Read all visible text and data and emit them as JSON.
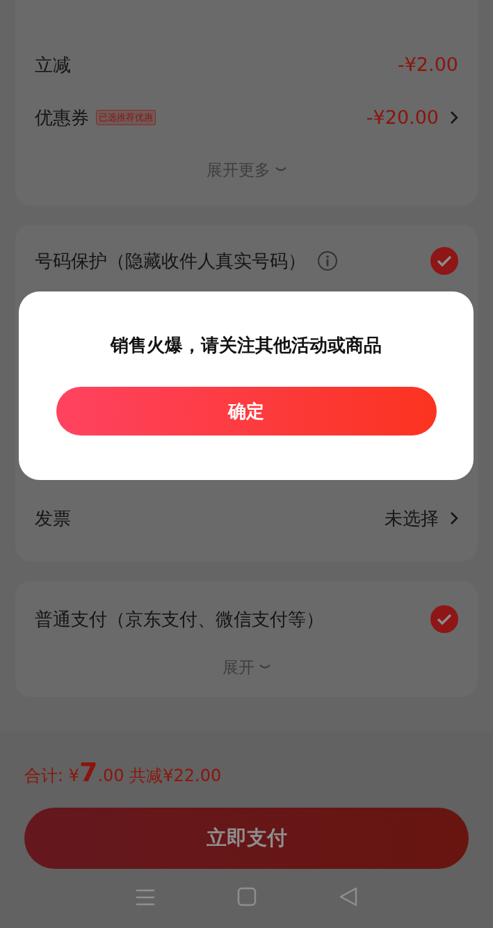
{
  "discounts": {
    "rows": [
      {
        "label": "立减",
        "amount": "-¥2.00",
        "chevron": false
      },
      {
        "label": "优惠券",
        "tag": "已选推荐优惠",
        "amount": "-¥20.00",
        "chevron": true
      }
    ],
    "expand": "展开更多"
  },
  "number_protection": {
    "label": "号码保护（隐藏收件人真实号码）",
    "checked": true
  },
  "invoice": {
    "label": "发票",
    "value": "未选择"
  },
  "payment": {
    "label": "普通支付（京东支付、微信支付等）",
    "checked": true,
    "expand": "展开"
  },
  "footer": {
    "total_label": "合计:",
    "currency": "¥",
    "total_integer": "7",
    "total_decimal": ".00",
    "saved": "共减¥22.00",
    "pay_button": "立即支付"
  },
  "dialog": {
    "message": "销售火爆，请关注其他活动或商品",
    "confirm": "确定"
  }
}
